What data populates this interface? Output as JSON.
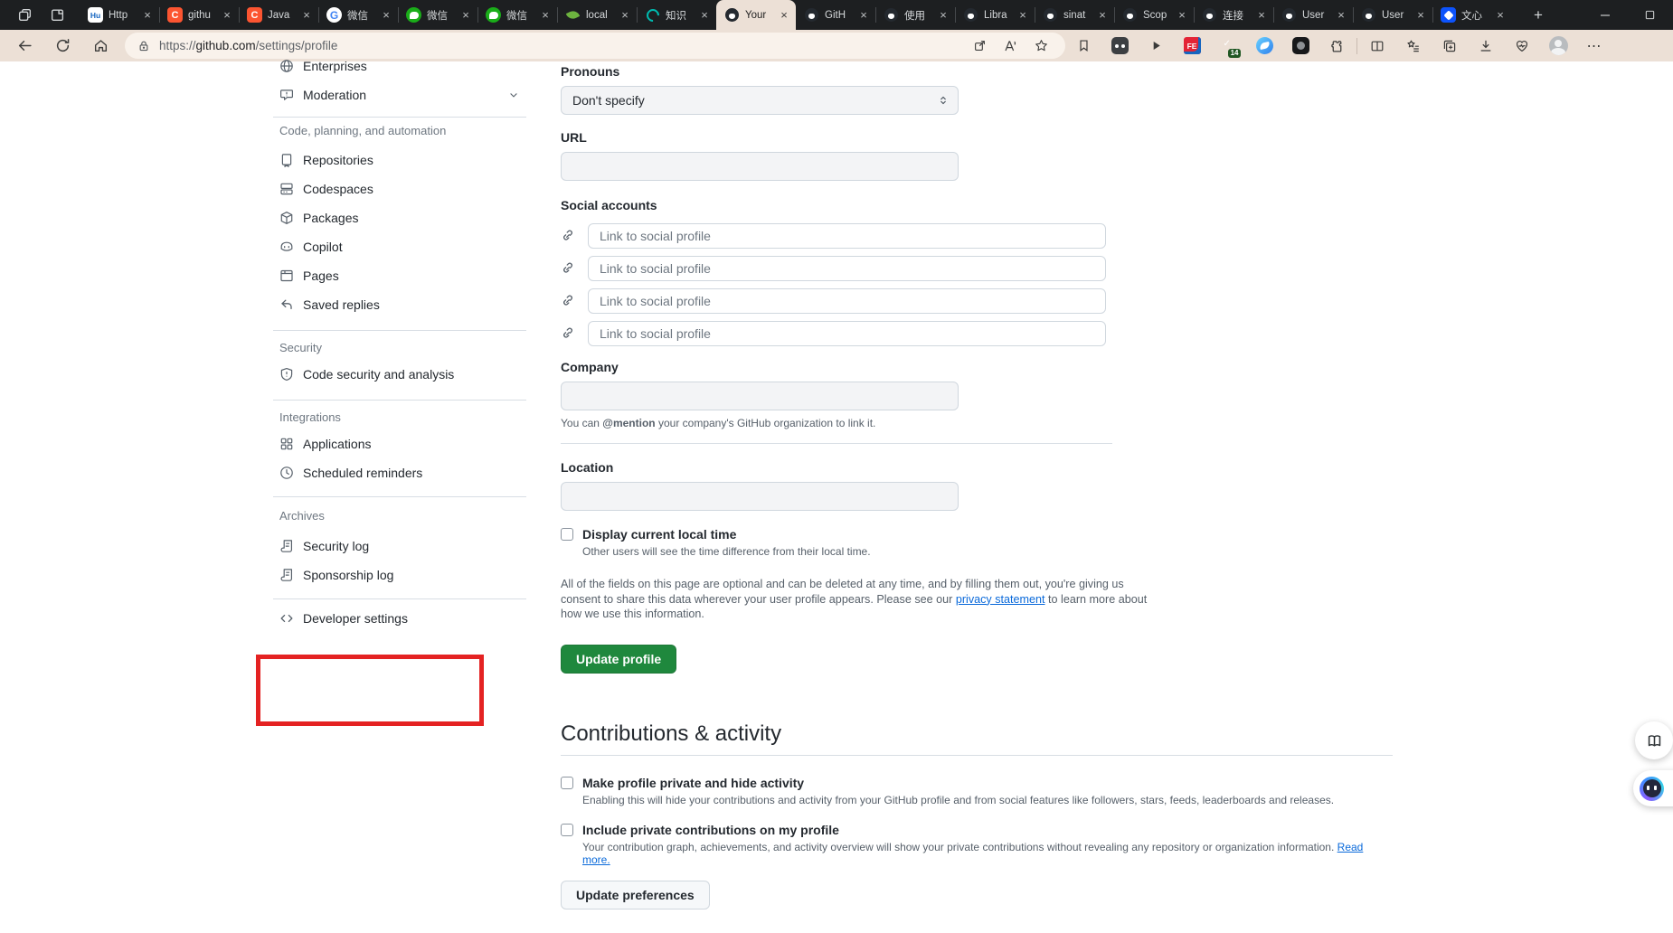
{
  "colors": {
    "accent_green": "#1f883d",
    "link_blue": "#0969da",
    "annotation_red": "#e42222",
    "toolbar_beige": "#ece0d6"
  },
  "browser": {
    "tabs": [
      {
        "title": "Http",
        "icon": "http-favicon",
        "active": false
      },
      {
        "title": "githu",
        "icon": "csdn-favicon",
        "active": false
      },
      {
        "title": "Java",
        "icon": "csdn-favicon",
        "active": false
      },
      {
        "title": "微信",
        "icon": "google-favicon",
        "active": false
      },
      {
        "title": "微信",
        "icon": "wechat-favicon",
        "active": false
      },
      {
        "title": "微信",
        "icon": "wechat-favicon",
        "active": false
      },
      {
        "title": "local",
        "icon": "spring-favicon",
        "active": false
      },
      {
        "title": "知识",
        "icon": "zsxq-favicon",
        "active": false
      },
      {
        "title": "Your",
        "icon": "github-favicon",
        "active": true
      },
      {
        "title": "GitH",
        "icon": "github-favicon",
        "active": false
      },
      {
        "title": "使用",
        "icon": "github-favicon",
        "active": false
      },
      {
        "title": "Libra",
        "icon": "github-favicon",
        "active": false
      },
      {
        "title": "sinat",
        "icon": "github-favicon",
        "active": false
      },
      {
        "title": "Scop",
        "icon": "github-favicon",
        "active": false
      },
      {
        "title": "连接",
        "icon": "github-favicon",
        "active": false
      },
      {
        "title": "User",
        "icon": "github-favicon",
        "active": false
      },
      {
        "title": "User",
        "icon": "github-favicon",
        "active": false
      },
      {
        "title": "文心",
        "icon": "wenxin-favicon",
        "active": false
      }
    ],
    "url": {
      "scheme": "https://",
      "host": "github.com",
      "path": "/settings/profile"
    },
    "shield_badge": "14"
  },
  "sidebar": {
    "top_items": [
      {
        "label": "Enterprises",
        "icon": "globe-icon"
      },
      {
        "label": "Moderation",
        "icon": "report-icon"
      }
    ],
    "sections": [
      {
        "header": "Code, planning, and automation",
        "items": [
          {
            "label": "Repositories",
            "icon": "repo-icon"
          },
          {
            "label": "Codespaces",
            "icon": "codespaces-icon"
          },
          {
            "label": "Packages",
            "icon": "package-icon"
          },
          {
            "label": "Copilot",
            "icon": "copilot-icon"
          },
          {
            "label": "Pages",
            "icon": "browser-icon"
          },
          {
            "label": "Saved replies",
            "icon": "reply-icon"
          }
        ]
      },
      {
        "header": "Security",
        "items": [
          {
            "label": "Code security and analysis",
            "icon": "shield-icon"
          }
        ]
      },
      {
        "header": "Integrations",
        "items": [
          {
            "label": "Applications",
            "icon": "apps-icon"
          },
          {
            "label": "Scheduled reminders",
            "icon": "clock-icon"
          }
        ]
      },
      {
        "header": "Archives",
        "items": [
          {
            "label": "Security log",
            "icon": "log-icon"
          },
          {
            "label": "Sponsorship log",
            "icon": "log-icon"
          }
        ]
      }
    ],
    "developer_settings": {
      "label": "Developer settings",
      "icon": "code-icon"
    }
  },
  "main": {
    "pronouns": {
      "label": "Pronouns",
      "value": "Don't specify"
    },
    "url_field": {
      "label": "URL",
      "value": ""
    },
    "social": {
      "label": "Social accounts",
      "placeholder": "Link to social profile"
    },
    "company": {
      "label": "Company",
      "value": "",
      "hint_prefix": "You can ",
      "hint_mention": "@mention",
      "hint_suffix": " your company's GitHub organization to link it."
    },
    "location": {
      "label": "Location",
      "value": ""
    },
    "local_time": {
      "label": "Display current local time",
      "hint": "Other users will see the time difference from their local time.",
      "checked": false
    },
    "note": {
      "before": "All of the fields on this page are optional and can be deleted at any time, and by filling them out, you're giving us consent to share this data wherever your user profile appears. Please see our ",
      "link": "privacy statement",
      "after": " to learn more about how we use this information."
    },
    "update_profile": "Update profile",
    "contributions": {
      "title": "Contributions & activity",
      "private_profile": {
        "label": "Make profile private and hide activity",
        "hint": "Enabling this will hide your contributions and activity from your GitHub profile and from social features like followers, stars, feeds, leaderboards and releases.",
        "checked": false
      },
      "private_contrib": {
        "label": "Include private contributions on my profile",
        "hint": "Your contribution graph, achievements, and activity overview will show your private contributions without revealing any repository or organization information. ",
        "link": "Read more.",
        "checked": false
      },
      "update_preferences": "Update preferences"
    }
  }
}
